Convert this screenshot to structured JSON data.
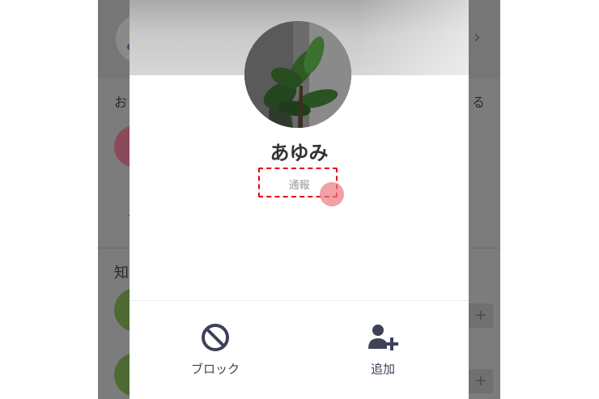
{
  "background": {
    "visible_fragments": {
      "left_top_char": "お",
      "right_top_char": "る",
      "section_char": "知",
      "add_glyph": "+"
    },
    "chevron_glyph": "›"
  },
  "profile": {
    "name": "あゆみ",
    "report_label": "通報",
    "avatar_icon": "plant-photo"
  },
  "actions": {
    "block_label": "ブロック",
    "add_label": "追加",
    "block_icon": "block-icon",
    "add_icon": "add-friend-icon"
  },
  "colors": {
    "highlight": "#e60012",
    "tap_indicator": "#ee7880",
    "icon": "#3d4259"
  }
}
